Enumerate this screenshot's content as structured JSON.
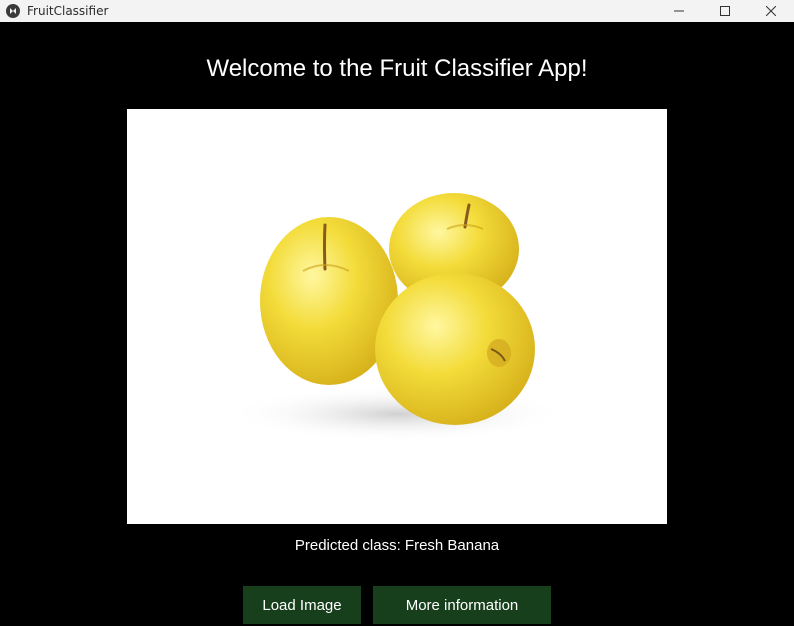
{
  "window": {
    "title": "FruitClassifier"
  },
  "main": {
    "heading": "Welcome to the Fruit Classifier App!",
    "prediction_text": "Predicted class: Fresh Banana"
  },
  "buttons": {
    "load_image": "Load Image",
    "more_information": "More information"
  },
  "colors": {
    "background": "#000000",
    "button": "#173f1c",
    "titlebar": "#f3f3f3"
  },
  "icons": {
    "app": "kivy-app-icon",
    "minimize": "minimize-icon",
    "maximize": "maximize-icon",
    "close": "close-icon"
  }
}
